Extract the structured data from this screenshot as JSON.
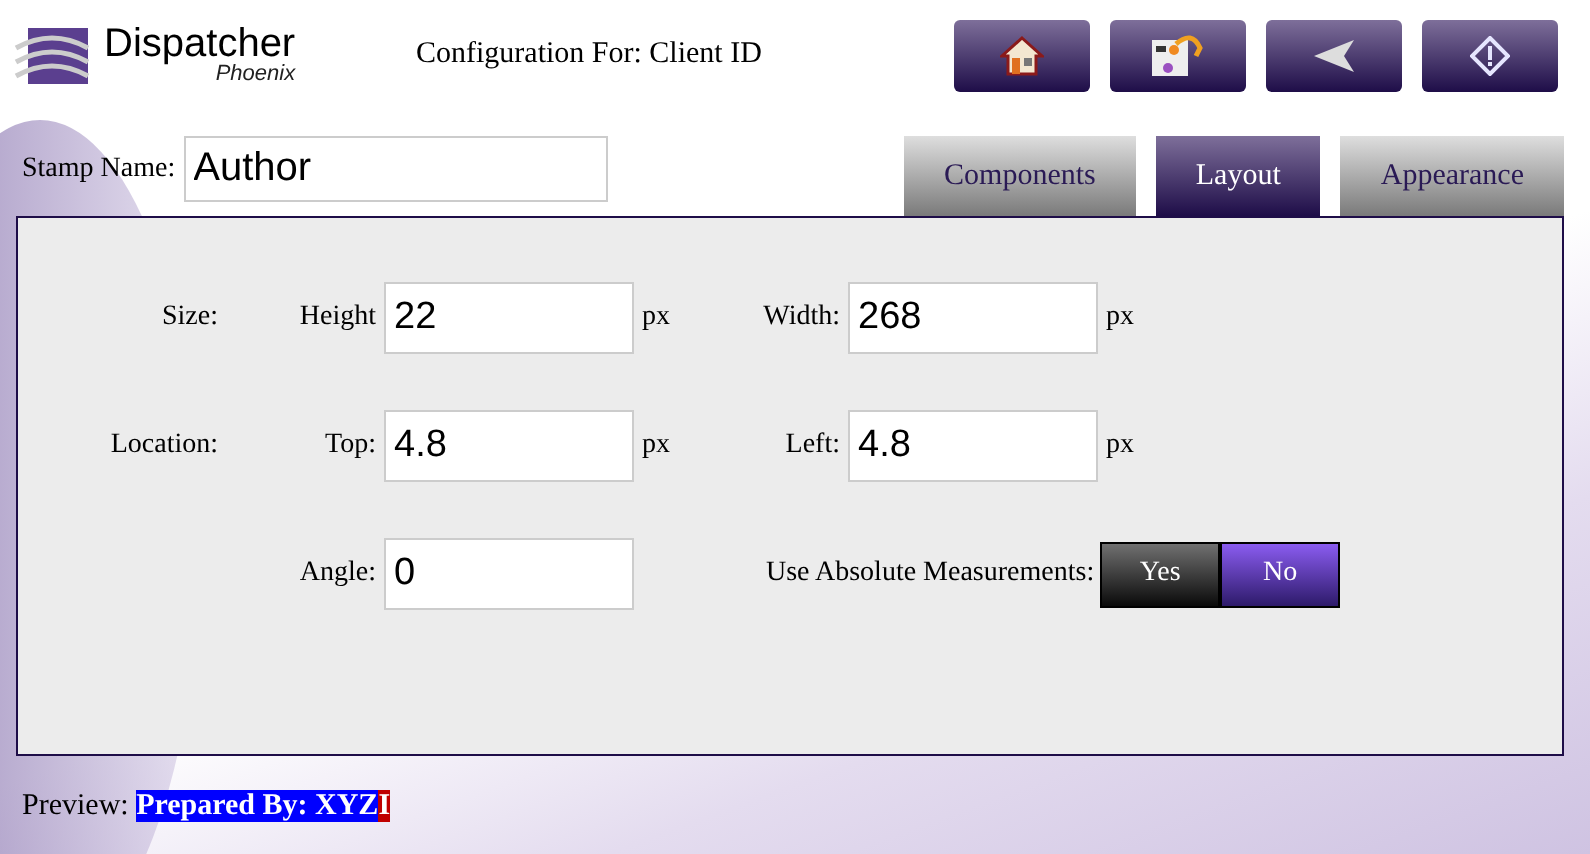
{
  "header": {
    "logo": {
      "name": "Dispatcher",
      "sub": "Phoenix"
    },
    "title": "Configuration For: Client ID",
    "toolbar": [
      {
        "kind": "home"
      },
      {
        "kind": "workflow"
      },
      {
        "kind": "back"
      },
      {
        "kind": "info"
      }
    ]
  },
  "stamp_name": {
    "label": "Stamp Name:",
    "value": "Author"
  },
  "tabs": [
    {
      "label": "Components",
      "selected": false
    },
    {
      "label": "Layout",
      "selected": true
    },
    {
      "label": "Appearance",
      "selected": false
    }
  ],
  "rows": [
    {
      "label": "Size:",
      "fields": [
        {
          "label": "Height",
          "value": "22",
          "unit": "px"
        },
        {
          "label": "Width:",
          "value": "268",
          "unit": "px"
        }
      ]
    },
    {
      "label": "Location:",
      "fields": [
        {
          "label": "Top:",
          "value": "4.8",
          "unit": "px"
        },
        {
          "label": "Left:",
          "value": "4.8",
          "unit": "px"
        }
      ]
    },
    {
      "fields": [
        {
          "label": "Angle:",
          "value": "0"
        }
      ],
      "toggle": {
        "label": "Use Absolute Measurements:",
        "options": [
          {
            "label": "Yes",
            "selected": false
          },
          {
            "label": "No",
            "selected": true
          }
        ]
      }
    }
  ],
  "preview": {
    "label": "Preview:",
    "segments": [
      {
        "text": "Prepared By: XYZ",
        "color": "#0000ff"
      },
      {
        "text": "I",
        "color": "#c00000"
      }
    ]
  }
}
